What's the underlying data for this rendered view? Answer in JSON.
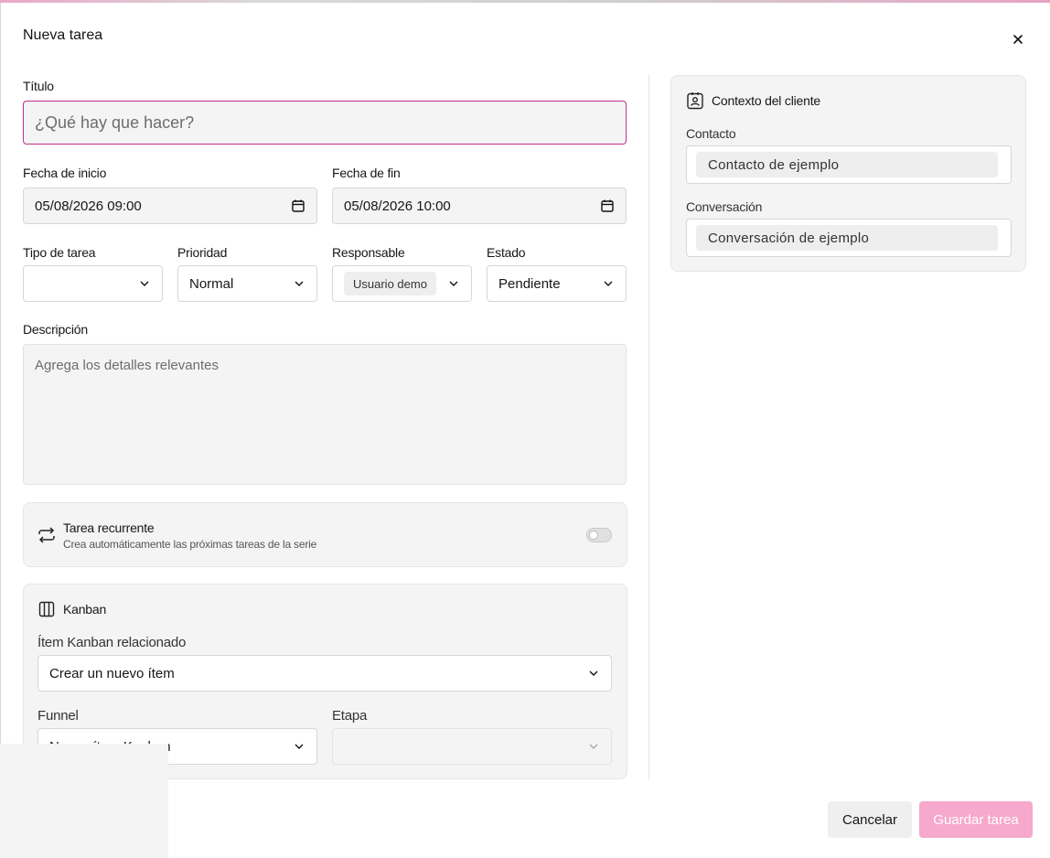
{
  "modal": {
    "title": "Nueva tarea",
    "close_icon": "close-icon"
  },
  "form": {
    "title_label": "Título",
    "title_placeholder": "¿Qué hay que hacer?",
    "start_label": "Fecha de inicio",
    "start_value": "05/08/2026 09:00",
    "end_label": "Fecha de fin",
    "end_value": "05/08/2026 10:00",
    "type_label": "Tipo de tarea",
    "type_value": "",
    "priority_label": "Prioridad",
    "priority_value": "Normal",
    "assignee_label": "Responsable",
    "assignee_value": "Usuario demo",
    "status_label": "Estado",
    "status_value": "Pendiente",
    "description_label": "Descripción",
    "description_placeholder": "Agrega los detalles relevantes"
  },
  "recurring": {
    "icon": "repeat-icon",
    "title": "Tarea recurrente",
    "subtitle": "Crea automáticamente las próximas tareas de la serie",
    "enabled": false
  },
  "kanban": {
    "icon": "columns-icon",
    "title": "Kanban",
    "item_label": "Ítem Kanban relacionado",
    "item_value": "Crear un nuevo ítem",
    "funnel_label": "Funnel",
    "funnel_value": "Nuevo ítem Kanban",
    "stage_label": "Etapa",
    "stage_value": ""
  },
  "context": {
    "icon": "contact-card-icon",
    "title": "Contexto del cliente",
    "contact_label": "Contacto",
    "contact_value": "Contacto de ejemplo",
    "conversation_label": "Conversación",
    "conversation_value": "Conversación de ejemplo"
  },
  "footer": {
    "cancel_label": "Cancelar",
    "save_label": "Guardar tarea"
  },
  "colors": {
    "accent": "#c0308a",
    "save_button": "#f6a8cd",
    "field_bg": "#f4f4f4"
  }
}
